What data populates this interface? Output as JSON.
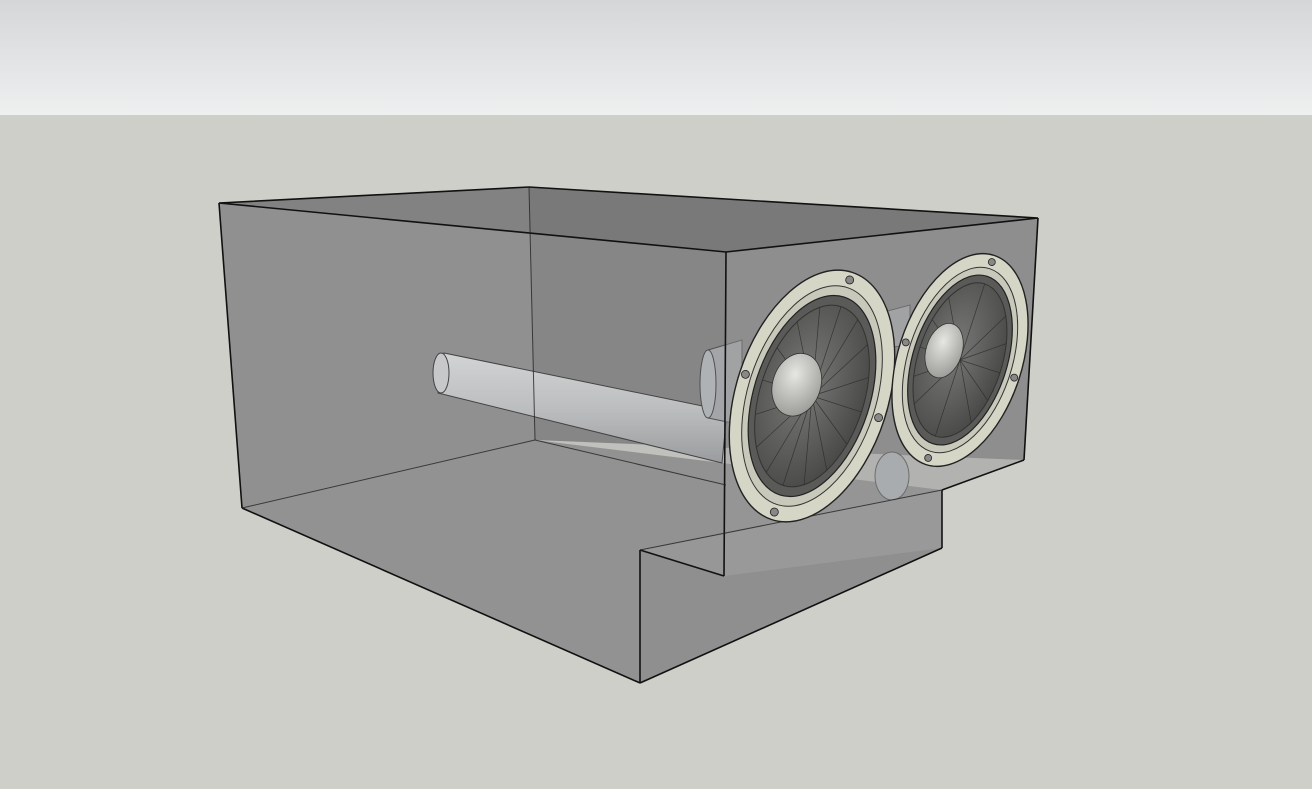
{
  "viewport": {
    "sky_color_top": "#d4d6d8",
    "sky_color_bottom": "#eef0f0",
    "ground_color": "#cfcfca"
  },
  "model": {
    "enclosure_face_color": "#8a8a8a",
    "edge_color": "#111111",
    "driver_ring_color": "#d6d6c6",
    "driver_cone_color": "#bcbcbc",
    "port_tube_color": "#c9ccce"
  }
}
